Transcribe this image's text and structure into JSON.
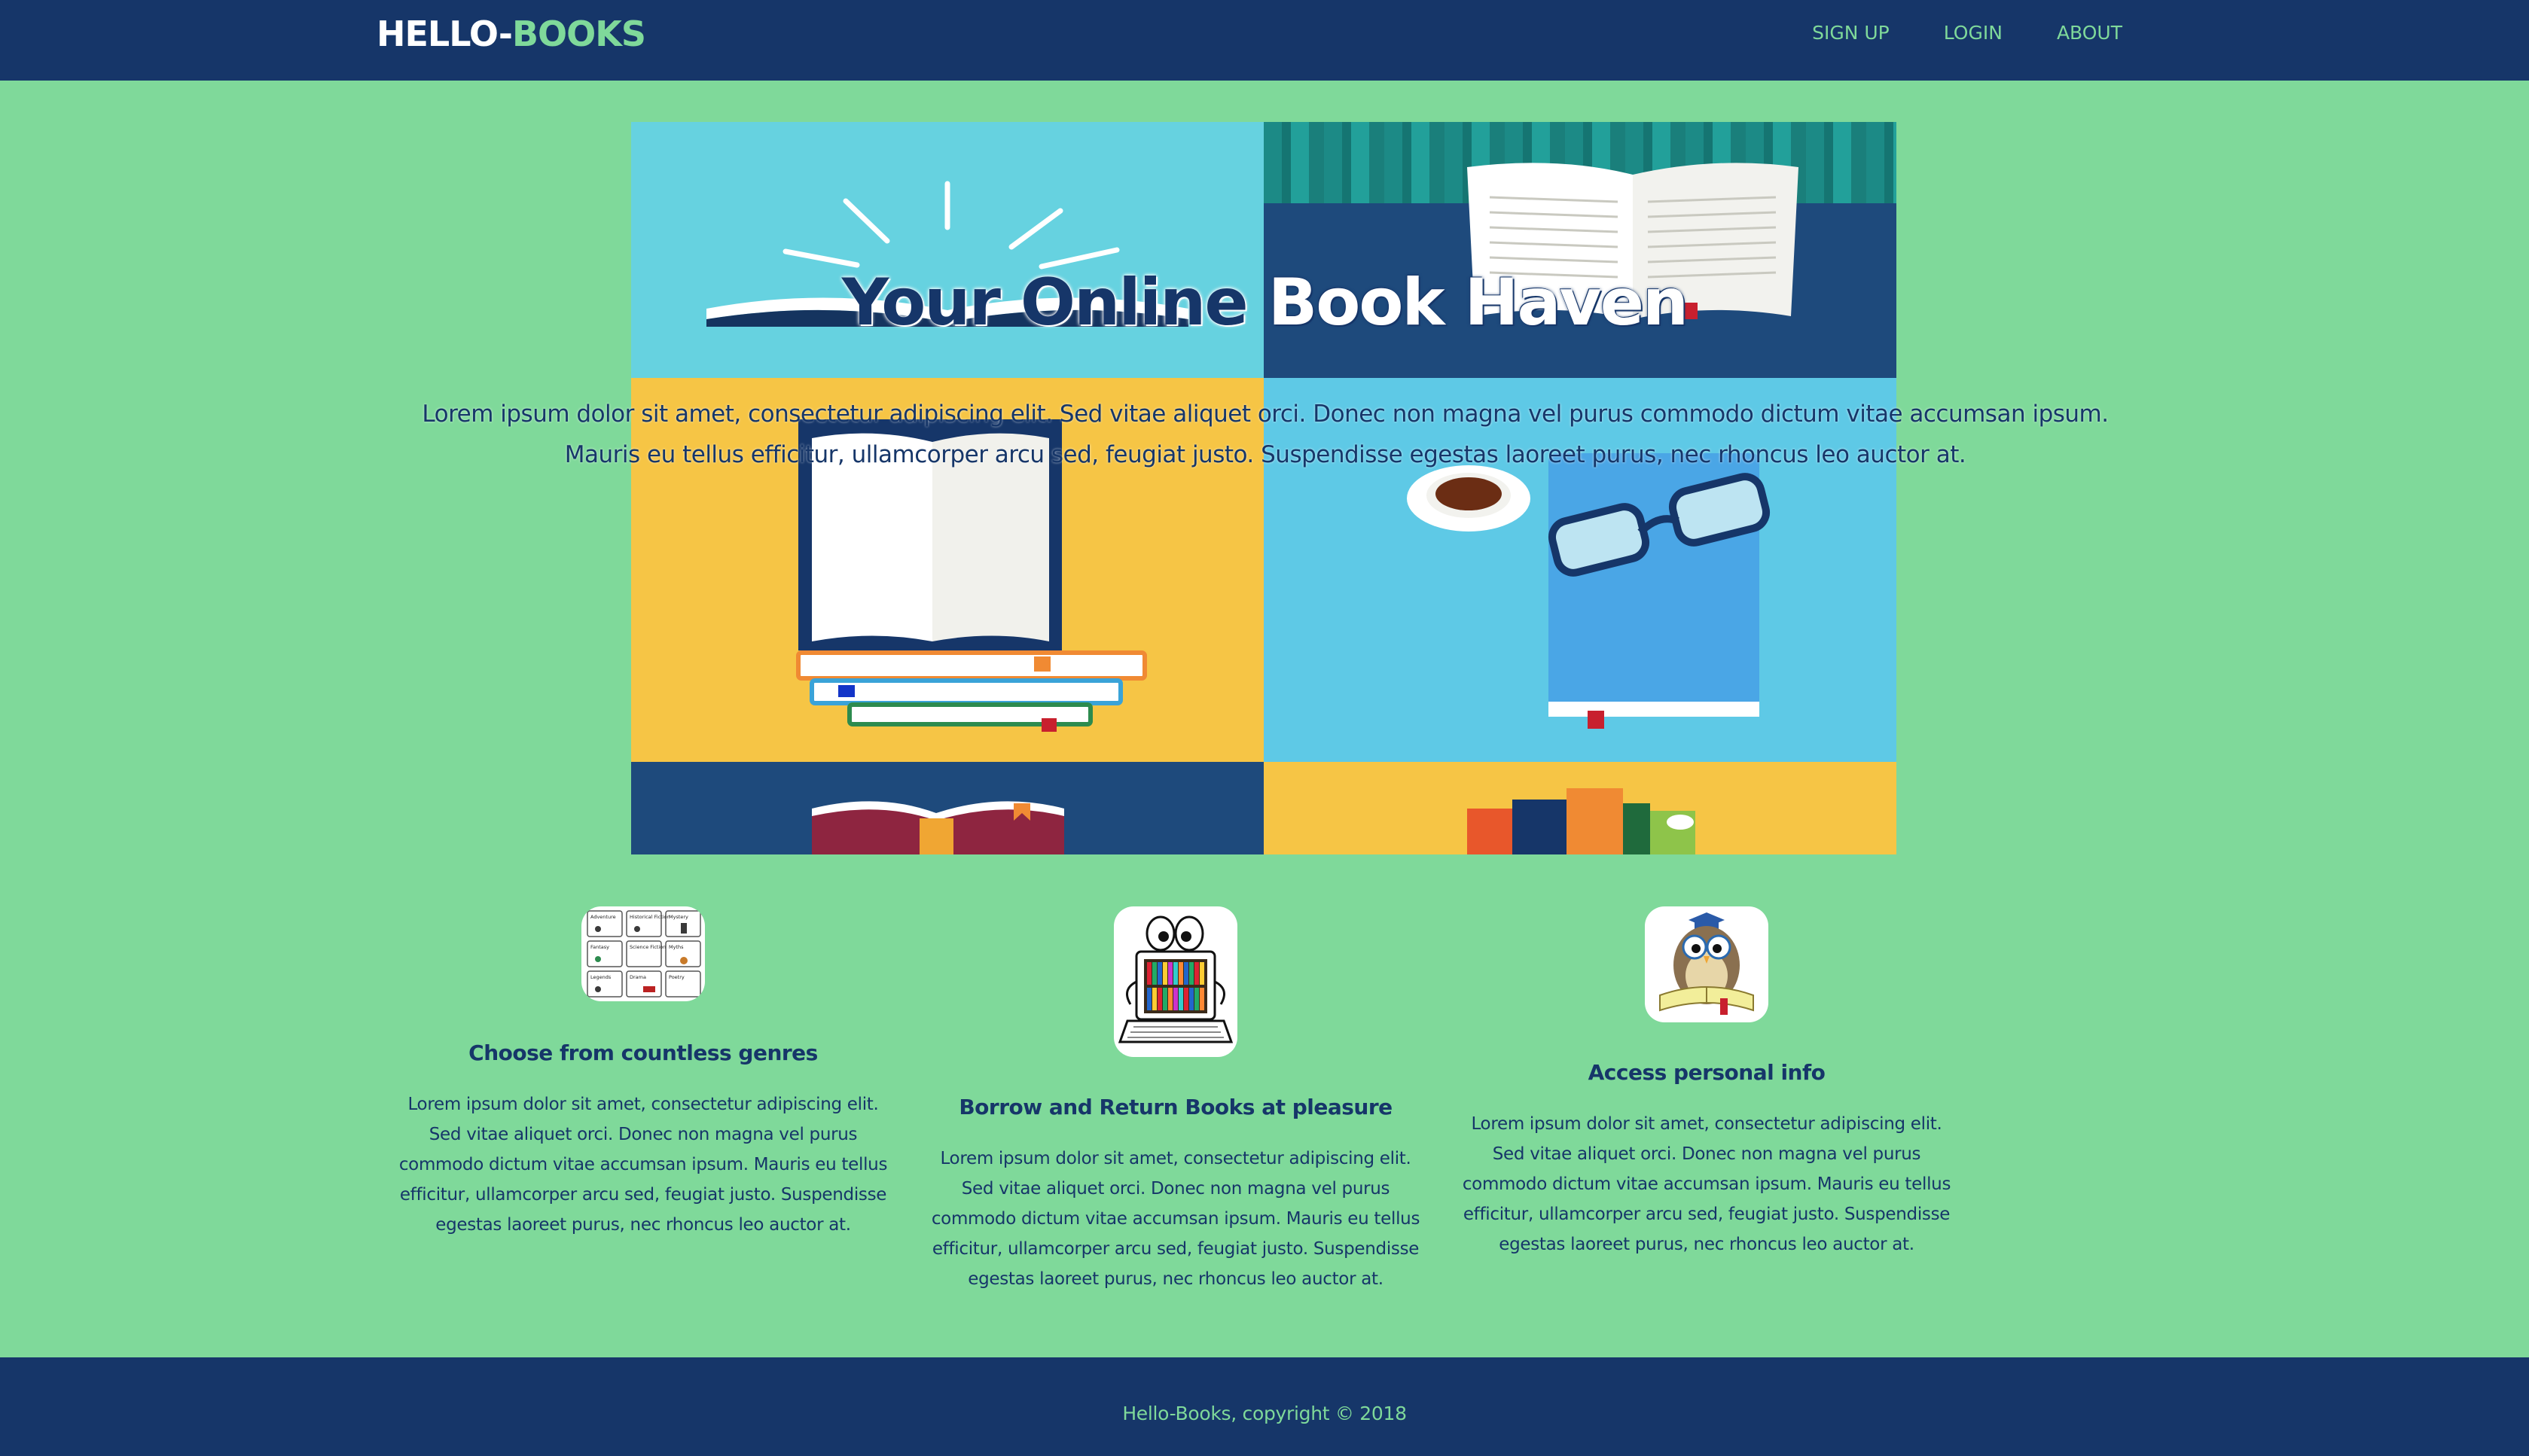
{
  "navbar": {
    "brand_part1": "HELLO-",
    "brand_part2": "BOOKS",
    "links": [
      "SIGN UP",
      "LOGIN",
      "ABOUT"
    ]
  },
  "hero": {
    "title_part1": "Your Online",
    "title_part2": "Book Haven",
    "description": "Lorem ipsum dolor sit amet, consectetur adipiscing elit. Sed vitae aliquet orci. Donec non magna vel purus commodo dictum vitae accumsan ipsum. Mauris eu tellus efficitur, ullamcorper arcu sed, feugiat justo. Suspendisse egestas laoreet purus, nec rhoncus leo auctor at."
  },
  "features": [
    {
      "icon": "genres-grid-icon",
      "title": "Choose from countless genres",
      "text": "Lorem ipsum dolor sit amet, consectetur adipiscing elit. Sed vitae aliquet orci. Donec non magna vel purus commodo dictum vitae accumsan ipsum. Mauris eu tellus efficitur, ullamcorper arcu sed, feugiat justo. Suspendisse egestas laoreet purus, nec rhoncus leo auctor at.",
      "genre_labels": [
        "Adventure",
        "Historical Fiction",
        "Mystery",
        "Fantasy",
        "Science Fiction",
        "Myths",
        "Legends",
        "Drama",
        "Poetry"
      ]
    },
    {
      "icon": "laptop-bookshelf-icon",
      "title": "Borrow and Return Books at pleasure",
      "text": "Lorem ipsum dolor sit amet, consectetur adipiscing elit. Sed vitae aliquet orci. Donec non magna vel purus commodo dictum vitae accumsan ipsum. Mauris eu tellus efficitur, ullamcorper arcu sed, feugiat justo. Suspendisse egestas laoreet purus, nec rhoncus leo auctor at."
    },
    {
      "icon": "owl-reading-icon",
      "title": "Access personal info",
      "text": "Lorem ipsum dolor sit amet, consectetur adipiscing elit. Sed vitae aliquet orci. Donec non magna vel purus commodo dictum vitae accumsan ipsum. Mauris eu tellus efficitur, ullamcorper arcu sed, feugiat justo. Suspendisse egestas laoreet purus, nec rhoncus leo auctor at."
    }
  ],
  "footer": {
    "text": "Hello-Books, copyright © 2018"
  },
  "colors": {
    "navy": "#163669",
    "green": "#7fd99a",
    "white": "#ffffff"
  }
}
